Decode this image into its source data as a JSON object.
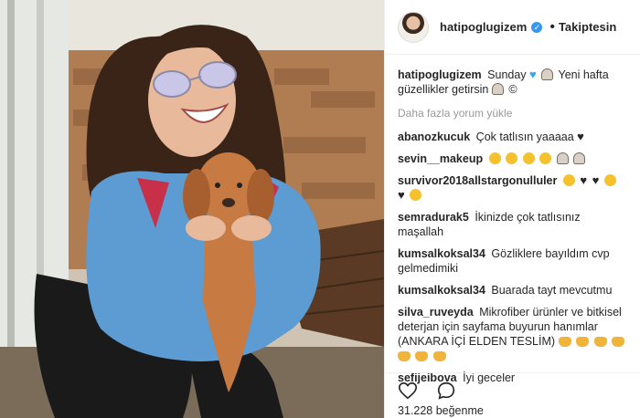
{
  "header": {
    "username": "hatipoglugizem",
    "separator": "•",
    "follow_status": "Takiptesin"
  },
  "caption": {
    "username": "hatipoglugizem",
    "text_a": "Sunday",
    "text_b": "Yeni hafta güzellikler getirsin",
    "text_c": "©"
  },
  "more_comments": "Daha fazla yorum yükle",
  "comments": [
    {
      "user": "abanozkucuk",
      "text": "Çok tatlısın yaaaaa"
    },
    {
      "user": "sevin__makeup",
      "text": ""
    },
    {
      "user": "survivor2018allstargonulluler",
      "text": ""
    },
    {
      "user": "semradurak5",
      "text": "İkinizde çok tatlısınız maşallah"
    },
    {
      "user": "kumsalkoksal34",
      "text": "Gözliklere bayıldım cvp gelmedimiki"
    },
    {
      "user": "kumsalkoksal34",
      "text": "Buarada tayt mevcutmu"
    },
    {
      "user": "silva_ruveyda",
      "text": "Mikrofiber ürünler ve bitkisel deterjan için sayfama buyurun hanımlar (ANKARA İÇİ ELDEN TESLİM)"
    },
    {
      "user": "sefijeibova",
      "text": "İyi geceler"
    }
  ],
  "likes": "31.228 beğenme",
  "colors": {
    "verified": "#3897f0",
    "text": "#262626",
    "muted": "#999999"
  }
}
